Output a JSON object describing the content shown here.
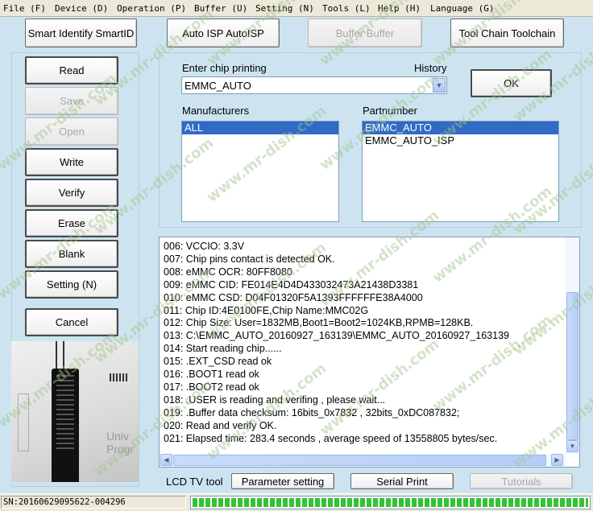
{
  "menu": [
    "File (F)",
    "Device (D)",
    "Operation (P)",
    "Buffer (U)",
    "Setting (N)",
    "Tools (L)",
    "Help (H)",
    "Language (G)"
  ],
  "toolbar": {
    "smart_identify": "Smart Identify SmartID",
    "auto_isp": "Auto ISP AutoISP",
    "buffer": "Buffer Buffer",
    "tool_chain": "Tool Chain Toolchain"
  },
  "side": {
    "read": "Read",
    "save": "Save",
    "open": "Open",
    "write": "Write",
    "verify": "Verify",
    "erase": "Erase",
    "blank": "Blank",
    "setting": "Setting (N)",
    "cancel": "Cancel"
  },
  "chip": {
    "enter_label": "Enter chip printing",
    "history_label": "History",
    "value": "EMMC_AUTO",
    "ok": "OK"
  },
  "manufacturers": {
    "label": "Manufacturers",
    "items": [
      "ALL"
    ],
    "selected": 0
  },
  "partnumber": {
    "label": "Partnumber",
    "items": [
      "EMMC_AUTO",
      "EMMC_AUTO_ISP"
    ],
    "selected": 0
  },
  "log": [
    "006:  VCCIO: 3.3V",
    "007:  Chip pins contact is detected OK.",
    "008:  eMMC OCR: 80FF8080",
    "009:  eMMC CID:  FE014E4D4D433032473A21438D3381",
    "010:  eMMC CSD: D04F01320F5A1393FFFFFFE38A4000",
    "011:  Chip ID:4E0100FE,Chip Name:MMC02G",
    "012:  Chip Size: User=1832MB,Boot1=Boot2=1024KB,RPMB=128KB.",
    "013:  C:\\EMMC_AUTO_20160927_163139\\EMMC_AUTO_20160927_163139",
    "014:  Start reading chip......",
    "015:  .EXT_CSD read ok",
    "016:  .BOOT1 read ok",
    "017:  .BOOT2 read ok",
    "018:  .USER  is reading and verifing , please wait...",
    "019:  .Buffer data checksum: 16bits_0x7832 , 32bits_0xDC087832;",
    "020:  Read and verify OK.",
    "021:  Elapsed time: 283.4 seconds , average speed of 13558805 bytes/sec."
  ],
  "bottom": {
    "lcd_label": "LCD TV tool",
    "parameter": "Parameter setting",
    "serial": "Serial Print",
    "tutorials": "Tutorials"
  },
  "status": {
    "sn": "SN:20160629095622-004296",
    "progress": 1.0
  },
  "watermark": "www.mr-dish.com",
  "device_photo_text": "Univ Progr"
}
